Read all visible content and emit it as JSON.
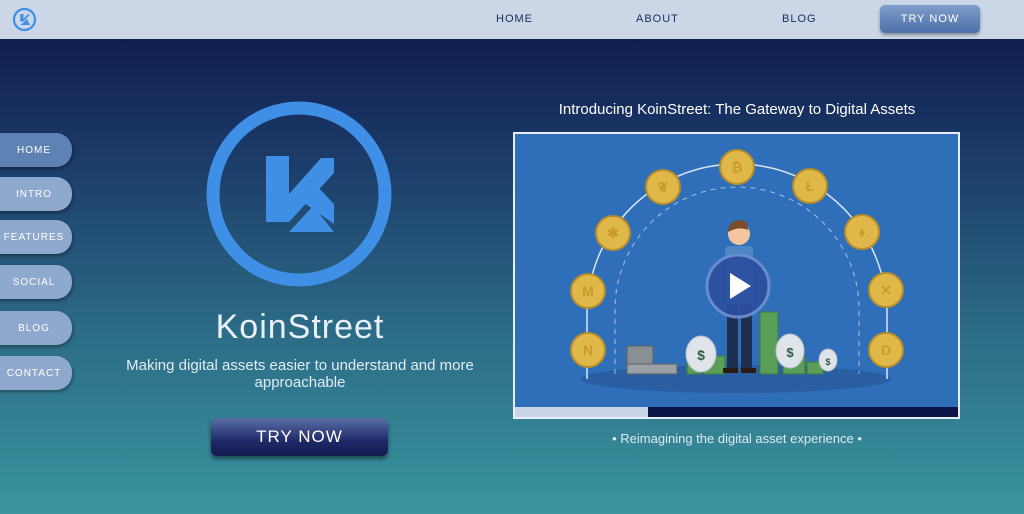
{
  "colors": {
    "accent": "#3f8fe6",
    "nav_text": "#1e2a5a",
    "top_bar": "#cbd7e6",
    "side_item": "#8ea9cd",
    "side_item_active": "#5e82b4"
  },
  "topnav": {
    "logo_icon": "koinstreet-logo-icon",
    "links": [
      "HOME",
      "ABOUT",
      "BLOG"
    ],
    "cta_label": "TRY NOW"
  },
  "sidenav": {
    "items": [
      "HOME",
      "INTRO",
      "FEATURES",
      "SOCIAL",
      "BLOG",
      "CONTACT"
    ],
    "active_index": 0
  },
  "hero": {
    "logo_icon": "koinstreet-logo-icon",
    "brand": "KoinStreet",
    "tagline": "Making digital assets easier to understand and more approachable",
    "cta_label": "TRY NOW"
  },
  "video": {
    "title": "Introducing KoinStreet: The Gateway to Digital Assets",
    "play_icon": "play-icon",
    "progress": 0.3,
    "caption": "• Reimagining the digital asset experience •"
  }
}
